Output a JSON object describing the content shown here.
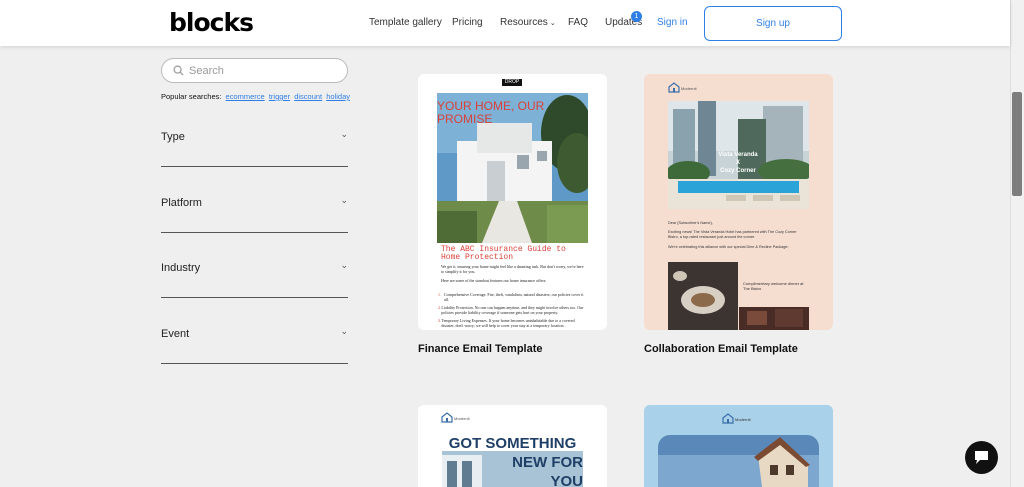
{
  "header": {
    "logo": "blocks",
    "nav": {
      "template_gallery": "Template gallery",
      "pricing": "Pricing",
      "resources": "Resources",
      "faq": "FAQ",
      "updates": "Updates",
      "updates_badge": "1",
      "sign_in": "Sign in",
      "sign_up": "Sign up"
    }
  },
  "sidebar": {
    "search_placeholder": "Search",
    "popular_label": "Popular searches:",
    "popular": [
      "ecommerce",
      "trigger",
      "discount",
      "holiday"
    ],
    "filters": [
      "Type",
      "Platform",
      "Industry",
      "Event"
    ]
  },
  "templates": [
    {
      "title": "Finance Email Template",
      "thumb": {
        "drop": "DROP",
        "headline": "YOUR HOME, OUR PROMISE",
        "subhead": "The ABC Insurance Guide to Home Protection",
        "body1": "We get it, insuring your home might feel like a daunting task. But don't worry, we're here to simplify it for you.",
        "body2": "Here are some of the standout features our home insurance offers:",
        "items": [
          "Comprehensive Coverage. Fire, theft, vandalism, natural disasters; our policies cover it all.",
          "Liability Protection. No one can happen anytime, and they might involve others too. Our policies provide liability coverage if someone gets hurt on your property.",
          "Temporary Living Expenses. If your home becomes uninhabitable due to a covered disaster, don't worry; we will help to cover your stay at a temporary location."
        ]
      }
    },
    {
      "title": "Collaboration Email Template",
      "thumb": {
        "brand": "Modernit",
        "overlay_line1": "Vista Veranda",
        "overlay_line2": "X",
        "overlay_line3": "Cozy Corner",
        "greeting": "Dear {Subscriber's Name},",
        "body1": "Exciting news! The Vista Veranda Hotel has partnered with The Cozy Corner Bistro, a top-rated restaurant just around the corner.",
        "body2": "We're celebrating this alliance with our special Dine & Recline Package:",
        "caption": "Complimentary welcome dinner at The Bistro"
      }
    },
    {
      "title": "",
      "thumb": {
        "brand": "Modernit",
        "headline1": "GOT SOMETHING",
        "headline2": "NEW FOR",
        "headline3": "YOU"
      }
    },
    {
      "title": "",
      "thumb": {
        "brand": "Modernit"
      }
    }
  ],
  "colors": {
    "accent": "#2f7fe6",
    "page_bg": "#efefef",
    "finance_headline": "#d9413a"
  }
}
